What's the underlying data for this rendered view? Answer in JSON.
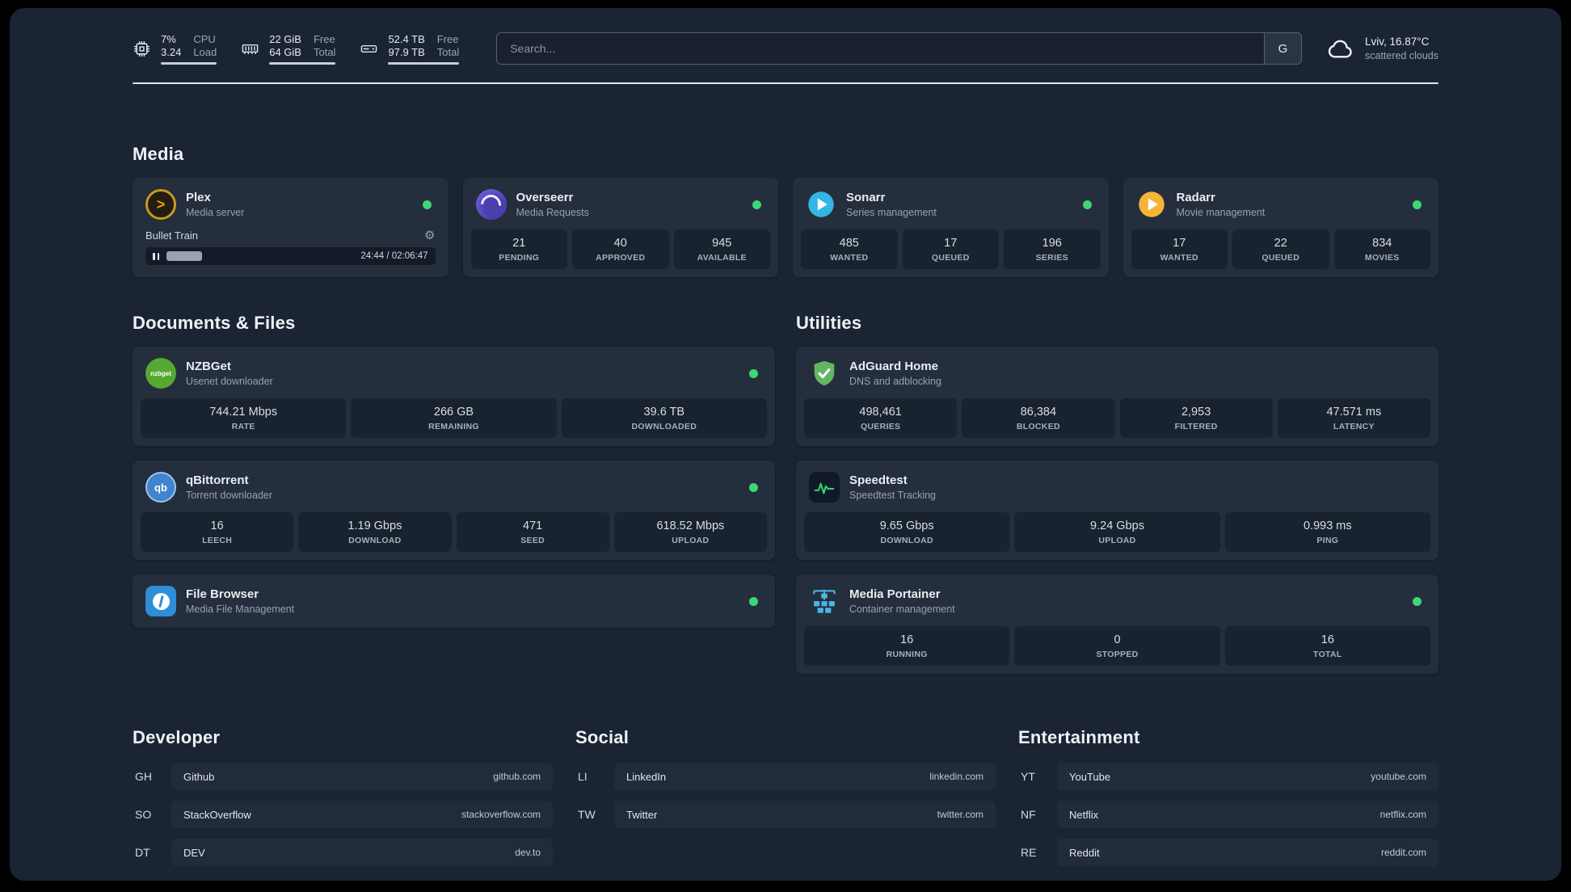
{
  "colors": {
    "background": "#1b2433",
    "card": "#242e3c",
    "tile": "#19222f",
    "status-green": "#3fd776",
    "divider": "#dfe5ec",
    "plex-amber": "#e5a00d",
    "overseerr-purple": "#6a5cd6",
    "sonarr-blue": "#34b6e4",
    "radarr-amber": "#f6b437",
    "nzbget-green": "#55a933",
    "qbittorrent-blue": "#4084cf",
    "filebrowser-blue": "#2e8ed7",
    "adguard-green": "#66b465",
    "speedtest-green": "#2dd36f",
    "portainer-blue": "#45b6e6"
  },
  "topbar": {
    "resources": [
      {
        "icon": "cpu-icon",
        "v1": "7%",
        "v2": "3.24",
        "l1": "CPU",
        "l2": "Load"
      },
      {
        "icon": "memory-icon",
        "v1": "22 GiB",
        "v2": "64 GiB",
        "l1": "Free",
        "l2": "Total"
      },
      {
        "icon": "disk-icon",
        "v1": "52.4 TB",
        "v2": "97.9 TB",
        "l1": "Free",
        "l2": "Total"
      }
    ],
    "search": {
      "placeholder": "Search...",
      "provider_button": "G"
    },
    "weather": {
      "location": "Lviv, 16.87°C",
      "condition": "scattered clouds"
    }
  },
  "media": {
    "title": "Media",
    "plex": {
      "title": "Plex",
      "subtitle": "Media server",
      "status": "online",
      "now_playing": "Bullet Train",
      "time": "24:44 / 02:06:47",
      "progress_percent": 19
    },
    "overseerr": {
      "title": "Overseerr",
      "subtitle": "Media Requests",
      "status": "online",
      "stats": [
        {
          "value": "21",
          "label": "PENDING"
        },
        {
          "value": "40",
          "label": "APPROVED"
        },
        {
          "value": "945",
          "label": "AVAILABLE"
        }
      ]
    },
    "sonarr": {
      "title": "Sonarr",
      "subtitle": "Series management",
      "status": "online",
      "stats": [
        {
          "value": "485",
          "label": "WANTED"
        },
        {
          "value": "17",
          "label": "QUEUED"
        },
        {
          "value": "196",
          "label": "SERIES"
        }
      ]
    },
    "radarr": {
      "title": "Radarr",
      "subtitle": "Movie management",
      "status": "online",
      "stats": [
        {
          "value": "17",
          "label": "WANTED"
        },
        {
          "value": "22",
          "label": "QUEUED"
        },
        {
          "value": "834",
          "label": "MOVIES"
        }
      ]
    }
  },
  "documents": {
    "title": "Documents & Files",
    "nzbget": {
      "title": "NZBGet",
      "subtitle": "Usenet downloader",
      "icon_text": "nzbget",
      "status": "online",
      "stats": [
        {
          "value": "744.21 Mbps",
          "label": "RATE"
        },
        {
          "value": "266 GB",
          "label": "REMAINING"
        },
        {
          "value": "39.6 TB",
          "label": "DOWNLOADED"
        }
      ]
    },
    "qbittorrent": {
      "title": "qBittorrent",
      "subtitle": "Torrent downloader",
      "icon_text": "qb",
      "status": "online",
      "stats": [
        {
          "value": "16",
          "label": "LEECH"
        },
        {
          "value": "1.19 Gbps",
          "label": "DOWNLOAD"
        },
        {
          "value": "471",
          "label": "SEED"
        },
        {
          "value": "618.52 Mbps",
          "label": "UPLOAD"
        }
      ]
    },
    "filebrowser": {
      "title": "File Browser",
      "subtitle": "Media File Management",
      "status": "online"
    }
  },
  "utilities": {
    "title": "Utilities",
    "adguard": {
      "title": "AdGuard Home",
      "subtitle": "DNS and adblocking",
      "stats": [
        {
          "value": "498,461",
          "label": "QUERIES"
        },
        {
          "value": "86,384",
          "label": "BLOCKED"
        },
        {
          "value": "2,953",
          "label": "FILTERED"
        },
        {
          "value": "47.571 ms",
          "label": "LATENCY"
        }
      ]
    },
    "speedtest": {
      "title": "Speedtest",
      "subtitle": "Speedtest Tracking",
      "stats": [
        {
          "value": "9.65 Gbps",
          "label": "DOWNLOAD"
        },
        {
          "value": "9.24 Gbps",
          "label": "UPLOAD"
        },
        {
          "value": "0.993 ms",
          "label": "PING"
        }
      ]
    },
    "portainer": {
      "title": "Media Portainer",
      "subtitle": "Container management",
      "status": "online",
      "stats": [
        {
          "value": "16",
          "label": "RUNNING"
        },
        {
          "value": "0",
          "label": "STOPPED"
        },
        {
          "value": "16",
          "label": "TOTAL"
        }
      ]
    }
  },
  "bookmarks": {
    "groups": [
      {
        "title": "Developer",
        "items": [
          {
            "abbr": "GH",
            "name": "Github",
            "url": "github.com"
          },
          {
            "abbr": "SO",
            "name": "StackOverflow",
            "url": "stackoverflow.com"
          },
          {
            "abbr": "DT",
            "name": "DEV",
            "url": "dev.to"
          }
        ]
      },
      {
        "title": "Social",
        "items": [
          {
            "abbr": "LI",
            "name": "LinkedIn",
            "url": "linkedin.com"
          },
          {
            "abbr": "TW",
            "name": "Twitter",
            "url": "twitter.com"
          }
        ]
      },
      {
        "title": "Entertainment",
        "items": [
          {
            "abbr": "YT",
            "name": "YouTube",
            "url": "youtube.com"
          },
          {
            "abbr": "NF",
            "name": "Netflix",
            "url": "netflix.com"
          },
          {
            "abbr": "RE",
            "name": "Reddit",
            "url": "reddit.com"
          }
        ]
      }
    ]
  }
}
